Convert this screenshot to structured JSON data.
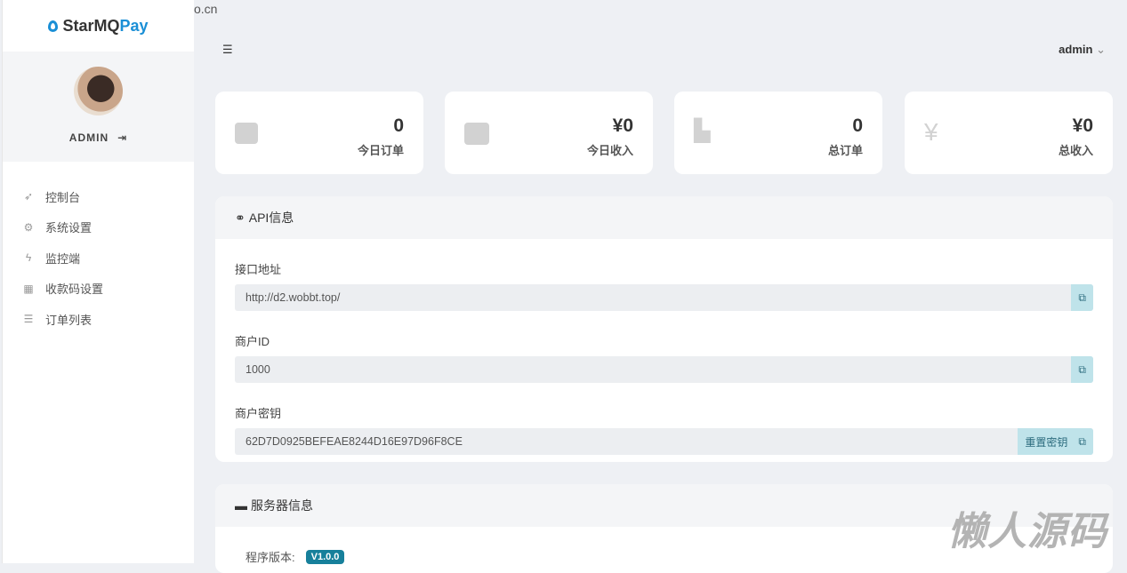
{
  "url_fragment": "o.cn",
  "brand": {
    "part1": "StarMQ",
    "part2": "Pay",
    "accent": "#1a8fd6"
  },
  "user": {
    "name": "ADMIN",
    "top_name": "admin"
  },
  "nav": [
    {
      "label": "控制台",
      "icon": "rocket-icon"
    },
    {
      "label": "系统设置",
      "icon": "gear-icon"
    },
    {
      "label": "监控端",
      "icon": "bolt-icon"
    },
    {
      "label": "收款码设置",
      "icon": "qrcode-icon"
    },
    {
      "label": "订单列表",
      "icon": "list-icon"
    }
  ],
  "stats": [
    {
      "value": "0",
      "label": "今日订单",
      "icon": "bag-icon"
    },
    {
      "value": "¥0",
      "label": "今日收入",
      "icon": "wallet-icon"
    },
    {
      "value": "0",
      "label": "总订单",
      "icon": "chart-icon"
    },
    {
      "value": "¥0",
      "label": "总收入",
      "icon": "yen-icon"
    }
  ],
  "api": {
    "title": "API信息",
    "fields": [
      {
        "label": "接口地址",
        "value": "http://d2.wobbt.top/"
      },
      {
        "label": "商户ID",
        "value": "1000"
      },
      {
        "label": "商户密钥",
        "value": "62D7D0925BEFEAE8244D16E97D96F8CE",
        "button": "重置密钥"
      }
    ]
  },
  "server": {
    "title": "服务器信息",
    "version_label": "程序版本:",
    "version": "V1.0.0"
  },
  "watermark": "懒人源码"
}
